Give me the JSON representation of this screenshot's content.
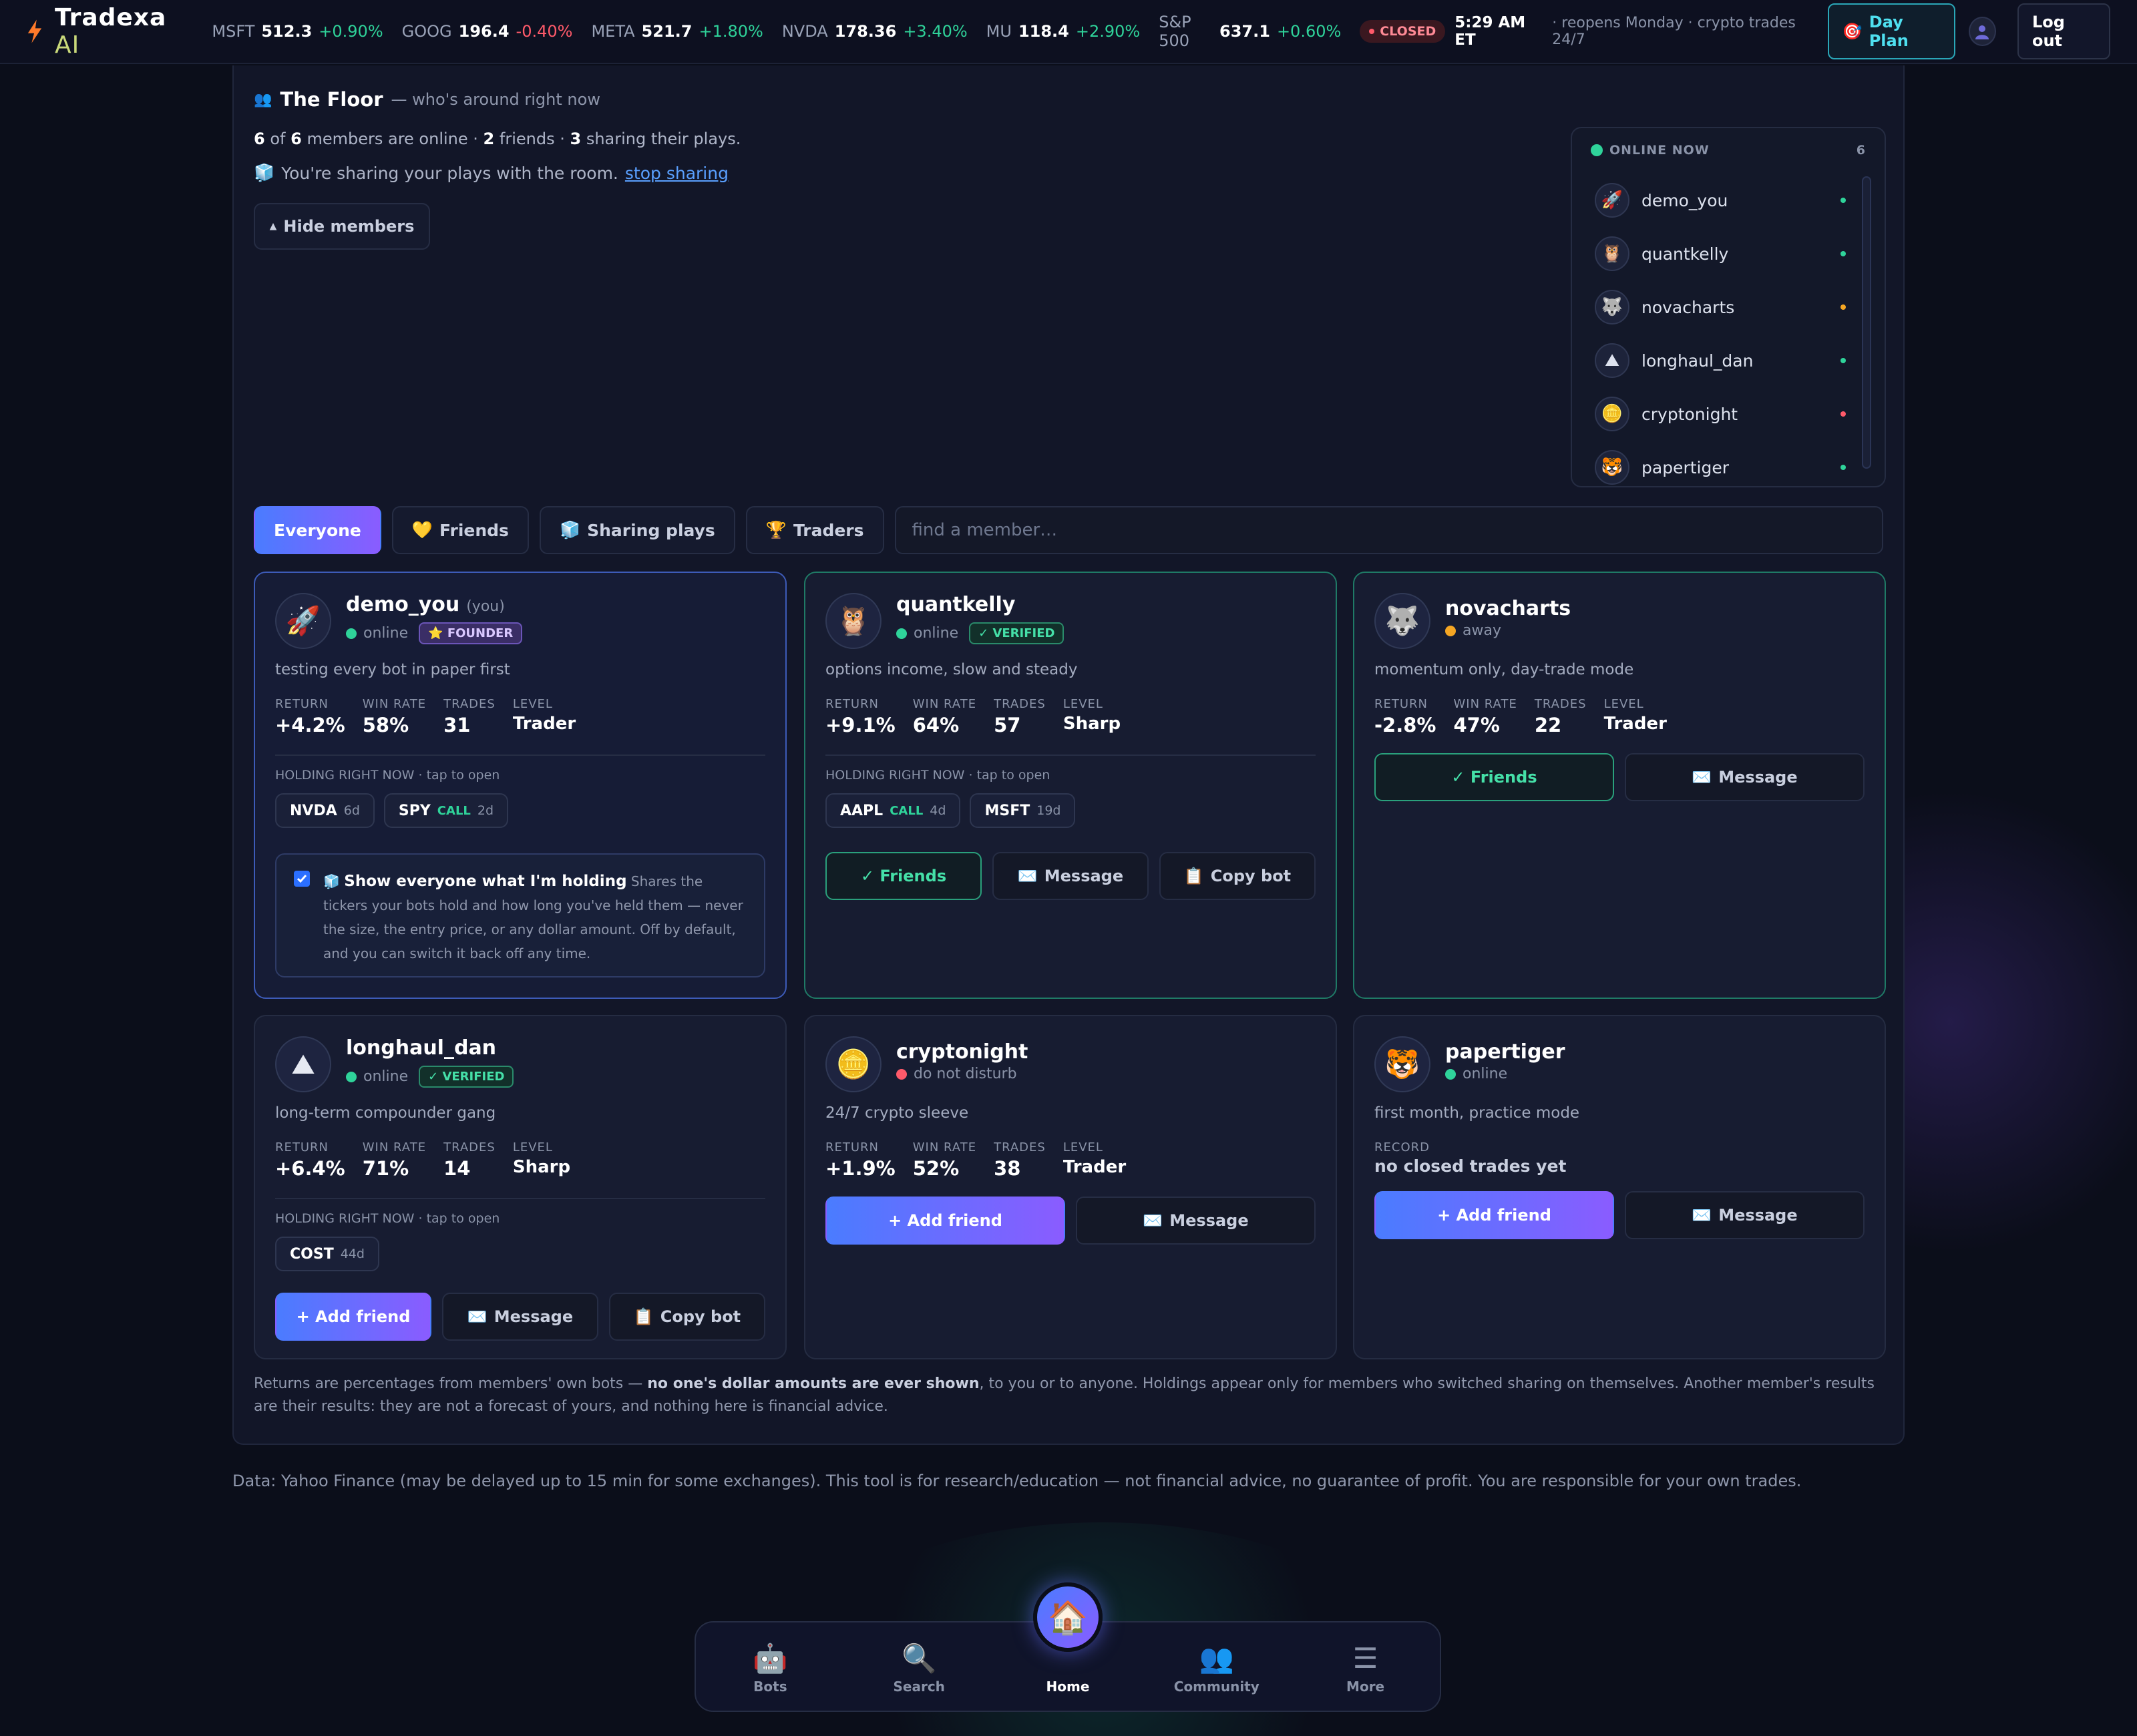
{
  "brand": {
    "name": "Tradexa",
    "ai": "AI"
  },
  "tickers": [
    {
      "sym": "MSFT",
      "price": "512.3",
      "chg": "+0.90%",
      "dir": "up"
    },
    {
      "sym": "GOOG",
      "price": "196.4",
      "chg": "-0.40%",
      "dir": "down"
    },
    {
      "sym": "META",
      "price": "521.7",
      "chg": "+1.80%",
      "dir": "up"
    },
    {
      "sym": "NVDA",
      "price": "178.36",
      "chg": "+3.40%",
      "dir": "up"
    },
    {
      "sym": "MU",
      "price": "118.4",
      "chg": "+2.90%",
      "dir": "up"
    },
    {
      "sym": "S&P 500",
      "price": "637.1",
      "chg": "+0.60%",
      "dir": "up"
    }
  ],
  "market": {
    "status": "CLOSED",
    "time": "5:29 AM ET",
    "note": "· reopens Monday · crypto trades 24/7"
  },
  "header": {
    "day_plan": "Day Plan",
    "logout": "Log out"
  },
  "floor": {
    "title": "The Floor",
    "subtitle": "— who's around right now",
    "online_count": "6",
    "member_count": "6",
    "friends_count": "2",
    "sharing_count": "3",
    "txt_of": "of",
    "txt_members_online": "members are online ·",
    "txt_friends": "friends ·",
    "txt_sharing": "sharing their plays.",
    "sharing_note": "You're sharing your plays with the room.",
    "stop_sharing": "stop sharing",
    "hide_members": "Hide members"
  },
  "online_now": {
    "title": "ONLINE NOW",
    "count": "6",
    "members": [
      {
        "name": "demo_you",
        "avatar": "🚀",
        "status": "online"
      },
      {
        "name": "quantkelly",
        "avatar": "🦉",
        "status": "online"
      },
      {
        "name": "novacharts",
        "avatar": "🐺",
        "status": "away"
      },
      {
        "name": "longhaul_dan",
        "avatar": "⛰",
        "status": "online"
      },
      {
        "name": "cryptonight",
        "avatar": "🪙",
        "status": "dnd"
      },
      {
        "name": "papertiger",
        "avatar": "🐯",
        "status": "online"
      }
    ]
  },
  "filters": {
    "everyone": "Everyone",
    "friends": "Friends",
    "sharing": "Sharing plays",
    "traders": "Traders",
    "search_placeholder": "find a member…"
  },
  "labels": {
    "return": "RETURN",
    "win_rate": "WIN RATE",
    "trades": "TRADES",
    "level": "LEVEL",
    "holding": "HOLDING RIGHT NOW · tap to open",
    "record": "RECORD"
  },
  "buttons": {
    "friends": "✓ Friends",
    "message": "Message",
    "copy_bot": "Copy bot",
    "add_friend": "+ Add friend"
  },
  "cards": [
    {
      "name": "demo_you",
      "you": "(you)",
      "avatar": "🚀",
      "status": "online",
      "badge": "FOUNDER",
      "bio": "testing every bot in paper first",
      "return": "+4.2%",
      "win_rate": "58%",
      "trades": "31",
      "level": "Trader",
      "holdings": [
        {
          "sym": "NVDA",
          "type": "",
          "dur": "6d"
        },
        {
          "sym": "SPY",
          "type": "CALL",
          "dur": "2d"
        }
      ],
      "share": {
        "heading": "Show everyone what I'm holding",
        "body": "Shares the tickers your bots hold and how long you've held them — never the size, the entry price, or any dollar amount. Off by default, and you can switch it back off any time."
      }
    },
    {
      "name": "quantkelly",
      "avatar": "🦉",
      "status": "online",
      "badge": "✓ VERIFIED",
      "bio": "options income, slow and steady",
      "return": "+9.1%",
      "win_rate": "64%",
      "trades": "57",
      "level": "Sharp",
      "holdings": [
        {
          "sym": "AAPL",
          "type": "CALL",
          "dur": "4d"
        },
        {
          "sym": "MSFT",
          "type": "",
          "dur": "19d"
        }
      ]
    },
    {
      "name": "novacharts",
      "avatar": "🐺",
      "status": "away",
      "bio": "momentum only, day-trade mode",
      "return": "-2.8%",
      "win_rate": "47%",
      "trades": "22",
      "level": "Trader"
    },
    {
      "name": "longhaul_dan",
      "avatar": "⛰",
      "status": "online",
      "badge": "✓ VERIFIED",
      "bio": "long-term compounder gang",
      "return": "+6.4%",
      "win_rate": "71%",
      "trades": "14",
      "level": "Sharp",
      "holdings": [
        {
          "sym": "COST",
          "type": "",
          "dur": "44d"
        }
      ]
    },
    {
      "name": "cryptonight",
      "avatar": "🪙",
      "status": "do not disturb",
      "bio": "24/7 crypto sleeve",
      "return": "+1.9%",
      "win_rate": "52%",
      "trades": "38",
      "level": "Trader"
    },
    {
      "name": "papertiger",
      "avatar": "🐯",
      "status": "online",
      "bio": "first month, practice mode",
      "record": "no closed trades yet"
    }
  ],
  "footnote": {
    "a": "Returns are percentages from members' own bots —",
    "b": "no one's dollar amounts are ever shown",
    "c": ", to you or to anyone. Holdings appear only for members who switched sharing on themselves. Another member's results are their results: they are not a forecast of yours, and nothing here is financial advice."
  },
  "disclaimer": "Data: Yahoo Finance (may be delayed up to 15 min for some exchanges). This tool is for research/education — not financial advice, no guarantee of profit. You are responsible for your own trades.",
  "nav": [
    {
      "label": "Bots",
      "icon": "🤖"
    },
    {
      "label": "Search",
      "icon": "🔍"
    },
    {
      "label": "Home",
      "icon": "🏠"
    },
    {
      "label": "Community",
      "icon": "👥"
    },
    {
      "label": "More",
      "icon": "☰"
    }
  ],
  "colors": {
    "online": "#2fd39a",
    "away": "#f5a623",
    "dnd": "#ff5a6a",
    "accent": "#4a7cff"
  }
}
